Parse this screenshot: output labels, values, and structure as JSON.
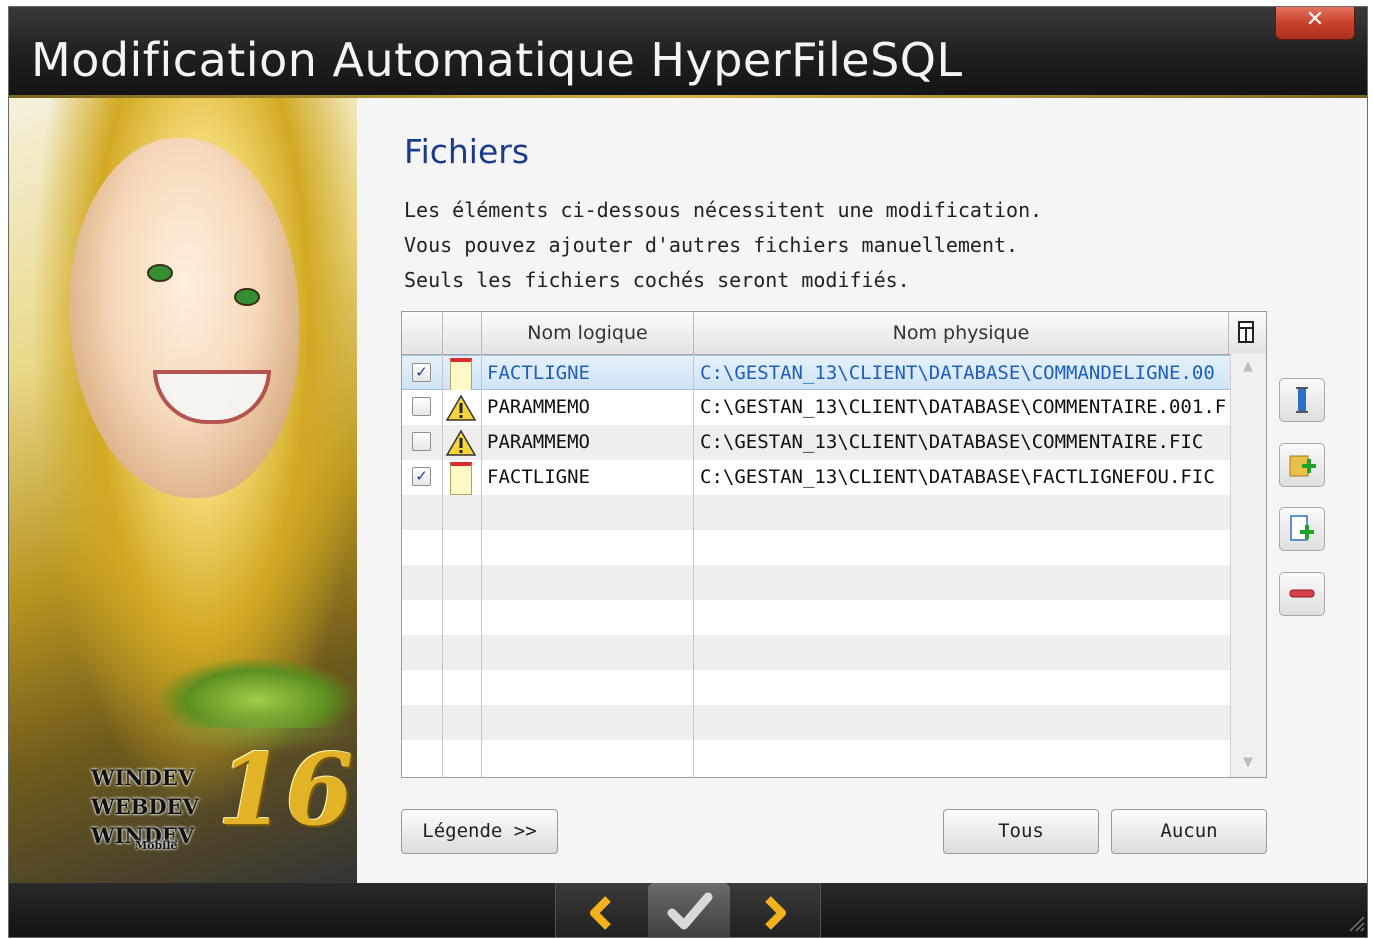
{
  "window": {
    "title": "Modification Automatique HyperFileSQL",
    "close_label": "✕"
  },
  "branding": {
    "products": [
      "WINDEV",
      "WEBDEV",
      "WINDEV"
    ],
    "mobile_tag": "Mobile",
    "version": "16"
  },
  "page": {
    "section_title": "Fichiers",
    "description": [
      "Les éléments ci-dessous nécessitent une modification.",
      "Vous pouvez ajouter d'autres fichiers manuellement.",
      "Seuls les fichiers cochés seront modifiés."
    ]
  },
  "table": {
    "columns": [
      "",
      "",
      "Nom logique",
      "Nom physique"
    ],
    "rows": [
      {
        "checked": true,
        "icon": "file-icon",
        "logical": "FACTLIGNE",
        "physical": "C:\\GESTAN_13\\CLIENT\\DATABASE\\COMMANDELIGNE.00",
        "selected": true
      },
      {
        "checked": false,
        "icon": "warning-icon",
        "logical": "PARAMMEMO",
        "physical": "C:\\GESTAN_13\\CLIENT\\DATABASE\\COMMENTAIRE.001.F",
        "selected": false
      },
      {
        "checked": false,
        "icon": "warning-icon",
        "logical": "PARAMMEMO",
        "physical": "C:\\GESTAN_13\\CLIENT\\DATABASE\\COMMENTAIRE.FIC",
        "selected": false
      },
      {
        "checked": true,
        "icon": "file-icon",
        "logical": "FACTLIGNE",
        "physical": "C:\\GESTAN_13\\CLIENT\\DATABASE\\FACTLIGNEFOU.FIC",
        "selected": false
      }
    ],
    "checkmark": "✓"
  },
  "side_buttons": [
    "column-icon",
    "add-folder-icon",
    "add-file-icon",
    "remove-icon"
  ],
  "buttons": {
    "legend": "Légende >>",
    "all": "Tous",
    "none": "Aucun"
  },
  "navigation": [
    "back-arrow-icon",
    "finish-check-icon",
    "next-arrow-icon"
  ],
  "colors": {
    "accent_title": "#1a3c8c",
    "selected_text": "#1f5fb8",
    "gold": "#e2b327",
    "close_red": "#c9442c"
  }
}
